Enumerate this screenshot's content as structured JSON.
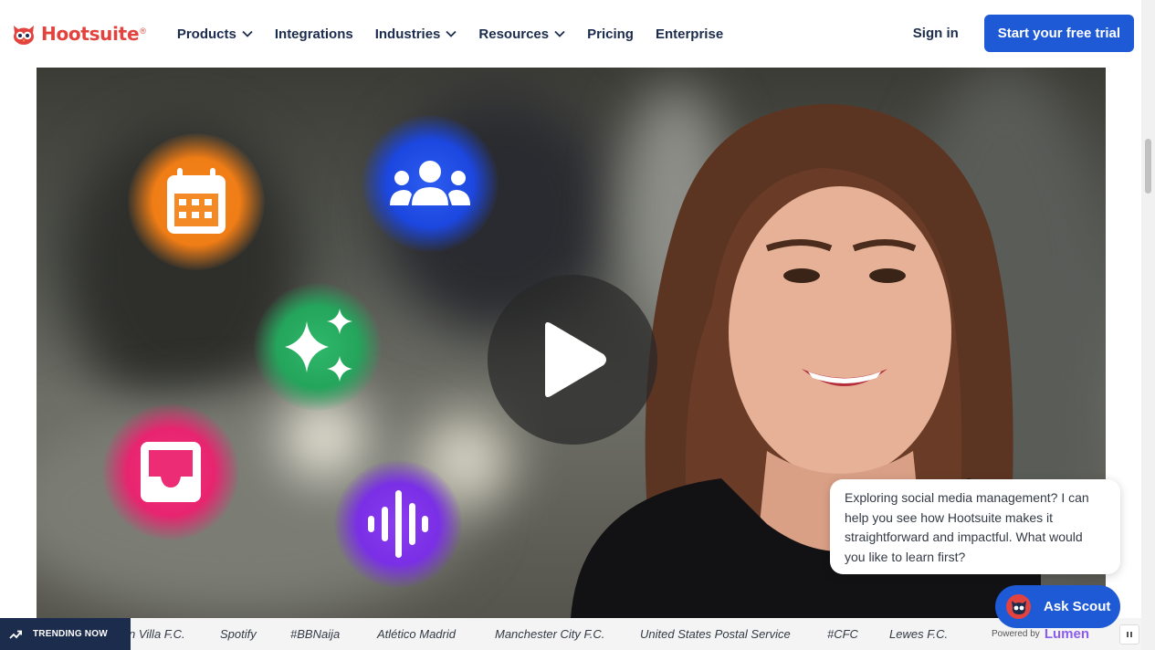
{
  "brand": {
    "name": "Hootsuite",
    "reg": "®",
    "color": "#e3433e"
  },
  "nav": {
    "items": [
      {
        "label": "Products",
        "dropdown": true
      },
      {
        "label": "Integrations",
        "dropdown": false
      },
      {
        "label": "Industries",
        "dropdown": true
      },
      {
        "label": "Resources",
        "dropdown": true
      },
      {
        "label": "Pricing",
        "dropdown": false
      },
      {
        "label": "Enterprise",
        "dropdown": false
      }
    ],
    "sign_in": "Sign in",
    "cta": "Start your free trial",
    "cta_color": "#1f5ad6"
  },
  "hero": {
    "icons": [
      "calendar-icon",
      "team-icon",
      "sparkles-icon",
      "inbox-icon",
      "audio-wave-icon"
    ],
    "play_icon": "play-icon"
  },
  "chat": {
    "message": "Exploring social media management? I can help you see how Hootsuite makes it straightforward and impactful. What would you like to learn first?",
    "button": "Ask Scout",
    "powered_prefix": "Powered by",
    "powered_brand": "Lumen"
  },
  "trending": {
    "label": "TRENDING NOW",
    "items": [
      "n Villa F.C.",
      "Spotify",
      "#BBNaija",
      "Atlético Madrid",
      "Manchester City F.C.",
      "United States Postal Service",
      "#CFC",
      "Lewes F.C."
    ]
  }
}
